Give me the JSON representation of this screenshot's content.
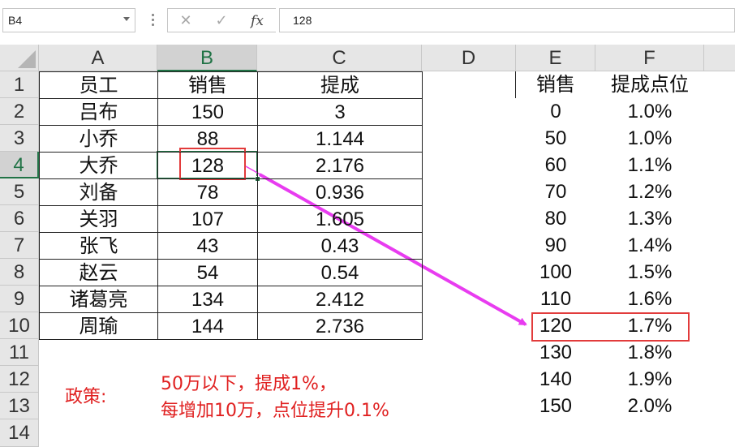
{
  "formula_bar": {
    "name_box": "B4",
    "cancel_icon": "x-icon",
    "enter_icon": "check-icon",
    "fx_label": "fx",
    "formula": "128"
  },
  "columns": [
    "A",
    "B",
    "C",
    "D",
    "E",
    "F"
  ],
  "rows": [
    "1",
    "2",
    "3",
    "4",
    "5",
    "6",
    "7",
    "8",
    "9",
    "10",
    "11",
    "12",
    "13",
    "14"
  ],
  "selected_cell": "B4",
  "table_main": {
    "headers": [
      "员工",
      "销售",
      "提成"
    ],
    "rows": [
      [
        "吕布",
        "150",
        "3"
      ],
      [
        "小乔",
        "88",
        "1.144"
      ],
      [
        "大乔",
        "128",
        "2.176"
      ],
      [
        "刘备",
        "78",
        "0.936"
      ],
      [
        "关羽",
        "107",
        "1.605"
      ],
      [
        "张飞",
        "43",
        "0.43"
      ],
      [
        "赵云",
        "54",
        "0.54"
      ],
      [
        "诸葛亮",
        "134",
        "2.412"
      ],
      [
        "周瑜",
        "144",
        "2.736"
      ]
    ]
  },
  "table_lookup": {
    "headers": [
      "销售",
      "提成点位"
    ],
    "rows": [
      [
        "0",
        "1.0%"
      ],
      [
        "50",
        "1.0%"
      ],
      [
        "60",
        "1.1%"
      ],
      [
        "70",
        "1.2%"
      ],
      [
        "80",
        "1.3%"
      ],
      [
        "90",
        "1.4%"
      ],
      [
        "100",
        "1.5%"
      ],
      [
        "110",
        "1.6%"
      ],
      [
        "120",
        "1.7%"
      ],
      [
        "130",
        "1.8%"
      ],
      [
        "140",
        "1.9%"
      ],
      [
        "150",
        "2.0%"
      ]
    ]
  },
  "policy": {
    "label": "政策:",
    "line1": "50万以下，提成1%，",
    "line2": "每增加10万，点位提升0.1%"
  },
  "colors": {
    "annotation_red": "#e23b3b",
    "arrow_magenta": "#e83cf0",
    "selection_green": "#217346",
    "policy_text": "#e02020"
  }
}
